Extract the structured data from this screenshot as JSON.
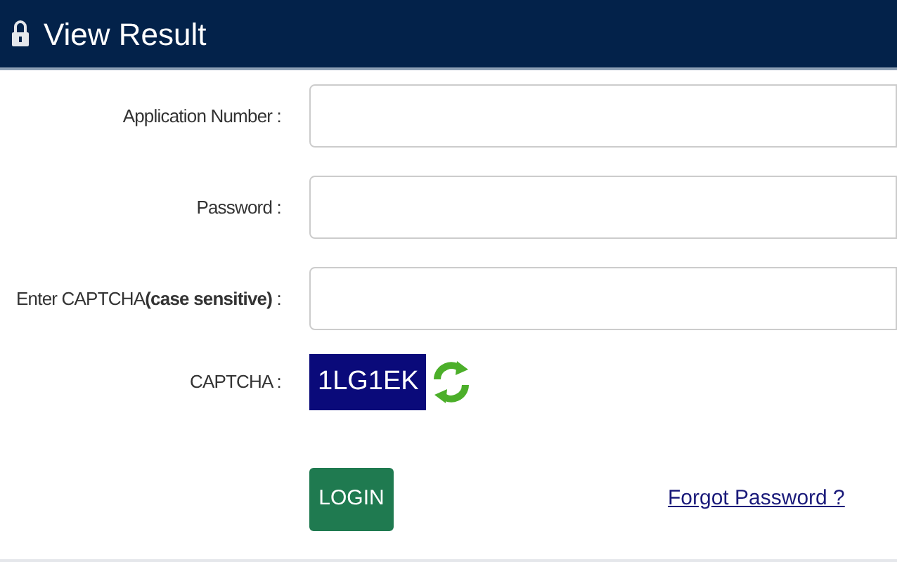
{
  "header": {
    "title": "View Result"
  },
  "fields": [
    {
      "label": "Application Number :"
    },
    {
      "label": "Password :"
    },
    {
      "label": "Enter CAPTCHA**(case sensitive)** :"
    }
  ],
  "captcha": {
    "label": "CAPTCHA :",
    "code": "1LG1EK"
  },
  "login_button": "LOGIN",
  "forgot_link": "Forgot Password ?"
}
